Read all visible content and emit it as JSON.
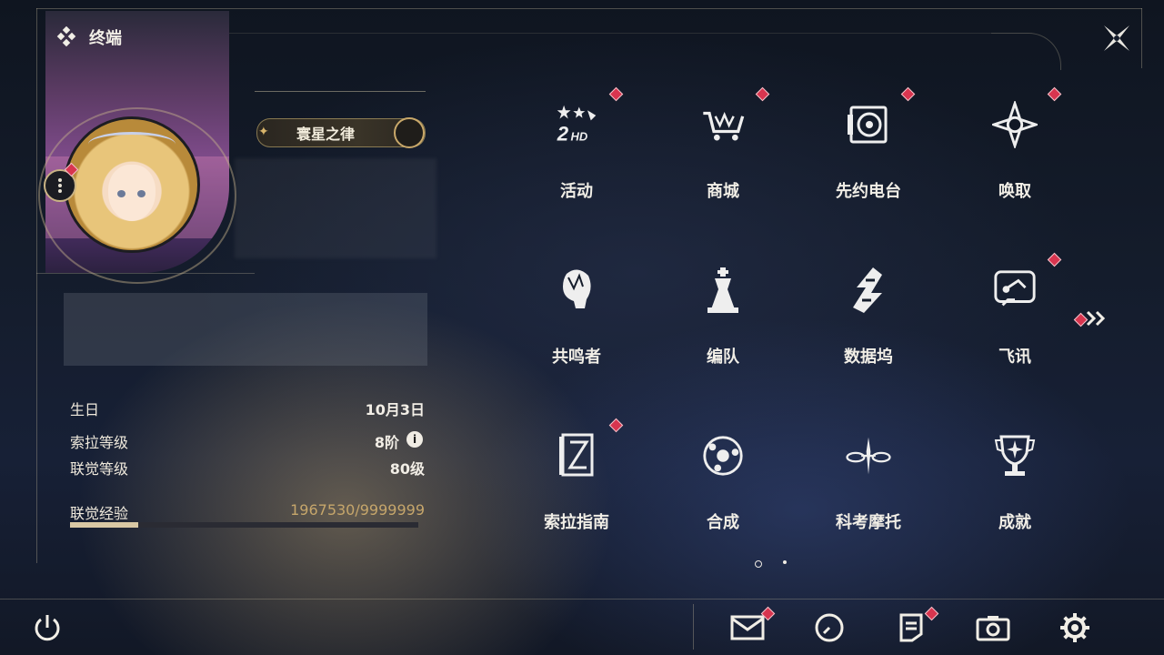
{
  "header": {
    "title": "终端",
    "icon": "diamond-cluster-icon"
  },
  "profile": {
    "name": "寰星之律",
    "stats": [
      {
        "label": "生日",
        "value": "10月3日"
      },
      {
        "label": "索拉等级",
        "value": "8阶"
      },
      {
        "label": "联觉等级",
        "value": "80级"
      }
    ],
    "exp": {
      "label": "联觉经验",
      "value": "1967530/9999999",
      "progress": 0.197
    }
  },
  "menu": [
    {
      "label": "活动",
      "icon": "event-2hd-icon",
      "badge": true
    },
    {
      "label": "商城",
      "icon": "shop-cart-icon",
      "badge": true
    },
    {
      "label": "先约电台",
      "icon": "radio-pass-icon",
      "badge": true
    },
    {
      "label": "唤取",
      "icon": "convene-star-icon",
      "badge": true
    },
    {
      "label": "共鸣者",
      "icon": "resonator-head-icon",
      "badge": false
    },
    {
      "label": "编队",
      "icon": "team-chess-icon",
      "badge": false
    },
    {
      "label": "数据坞",
      "icon": "data-bank-icon",
      "badge": false
    },
    {
      "label": "飞讯",
      "icon": "chat-message-icon",
      "badge": true
    },
    {
      "label": "索拉指南",
      "icon": "guidebook-icon",
      "badge": true
    },
    {
      "label": "合成",
      "icon": "synthesis-icon",
      "badge": false
    },
    {
      "label": "科考摩托",
      "icon": "motorbike-icon",
      "badge": false
    },
    {
      "label": "成就",
      "icon": "trophy-icon",
      "badge": false
    }
  ],
  "colors": {
    "badge": "#d8354f",
    "accent_gold": "#c9a86a",
    "exp_fill": "#d9c8a4"
  },
  "bottom_bar": [
    "power-icon",
    "mail-icon",
    "clock-icon",
    "notice-icon",
    "camera-icon",
    "settings-gear-icon"
  ]
}
